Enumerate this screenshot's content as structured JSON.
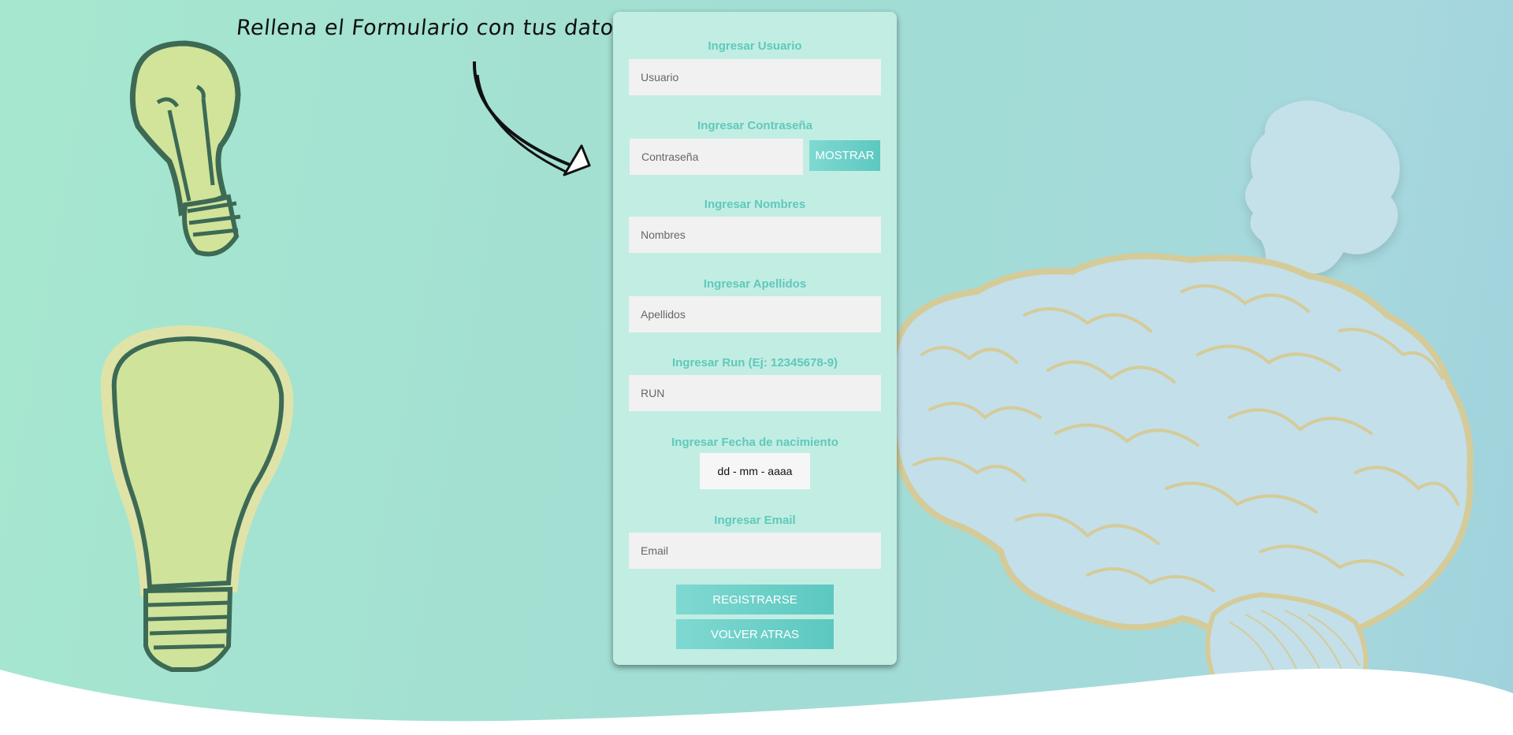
{
  "hint_text": "Rellena el Formulario con tus datos",
  "form": {
    "user_label": "Ingresar Usuario",
    "user_placeholder": "Usuario",
    "pass_label": "Ingresar Contraseña",
    "pass_placeholder": "Contraseña",
    "show_label": "MOSTRAR",
    "names_label": "Ingresar Nombres",
    "names_placeholder": "Nombres",
    "last_label": "Ingresar Apellidos",
    "last_placeholder": "Apellidos",
    "run_label": "Ingresar Run (Ej: 12345678-9)",
    "run_placeholder": "RUN",
    "date_label": "Ingresar Fecha de nacimiento",
    "date_value": "dd - mm - aaaa",
    "email_label": "Ingresar Email",
    "email_placeholder": "Email",
    "register_label": "REGISTRARSE",
    "back_label": "VOLVER ATRAS"
  },
  "colors": {
    "label": "#5fc9bb",
    "card": "#c2ede3",
    "button": "#5cc8c0"
  }
}
